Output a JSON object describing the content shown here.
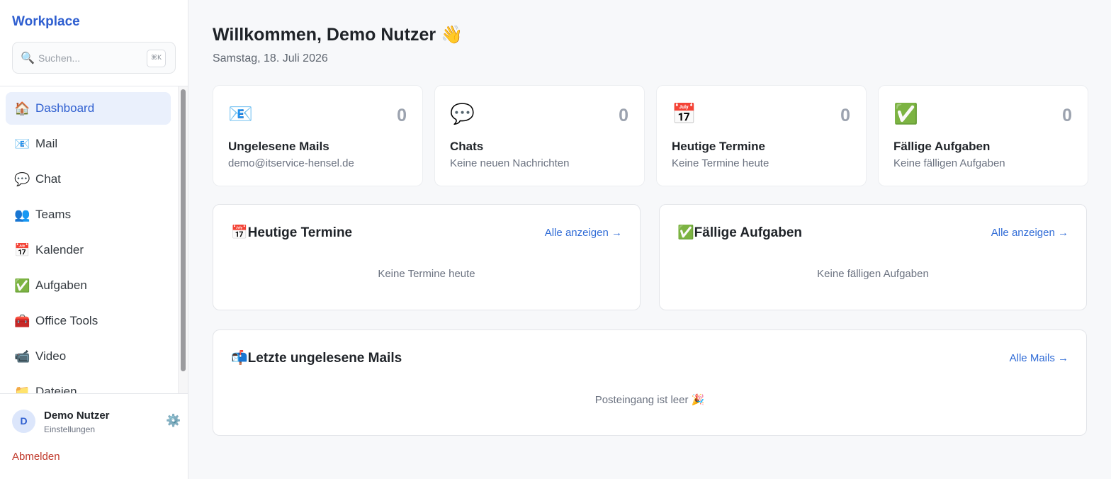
{
  "app": {
    "brand": "Workplace",
    "search_placeholder": "Suchen...",
    "search_shortcut": "⌘K"
  },
  "nav": [
    {
      "icon": "🏠",
      "icon_name": "house-icon",
      "label": "Dashboard",
      "active": true
    },
    {
      "icon": "📧",
      "icon_name": "mail-icon",
      "label": "Mail"
    },
    {
      "icon": "💬",
      "icon_name": "speech-bubble-icon",
      "label": "Chat"
    },
    {
      "icon": "👥",
      "icon_name": "people-icon",
      "label": "Teams"
    },
    {
      "icon": "📅",
      "icon_name": "calendar-icon",
      "label": "Kalender"
    },
    {
      "icon": "✅",
      "icon_name": "checkmark-icon",
      "label": "Aufgaben"
    },
    {
      "icon": "🧰",
      "icon_name": "toolbox-icon",
      "label": "Office Tools"
    },
    {
      "icon": "📹",
      "icon_name": "video-camera-icon",
      "label": "Video"
    },
    {
      "icon": "📁",
      "icon_name": "folder-icon",
      "label": "Dateien"
    }
  ],
  "user": {
    "initial": "D",
    "name": "Demo Nutzer",
    "sub": "Einstellungen",
    "settings_icon": "⚙️",
    "logout": "Abmelden"
  },
  "header": {
    "title": "Willkommen, Demo Nutzer 👋",
    "date": "Samstag, 18. Juli 2026"
  },
  "stats": [
    {
      "icon": "📧",
      "icon_name": "mail-icon",
      "value": "0",
      "title": "Ungelesene Mails",
      "sub": "demo@itservice-hensel.de"
    },
    {
      "icon": "💬",
      "icon_name": "speech-bubble-icon",
      "value": "0",
      "title": "Chats",
      "sub": "Keine neuen Nachrichten"
    },
    {
      "icon": "📅",
      "icon_name": "calendar-icon",
      "value": "0",
      "title": "Heutige Termine",
      "sub": "Keine Termine heute"
    },
    {
      "icon": "✅",
      "icon_name": "checkmark-icon",
      "value": "0",
      "title": "Fällige Aufgaben",
      "sub": "Keine fälligen Aufgaben"
    }
  ],
  "panels": {
    "termine": {
      "title": "📅Heutige Termine",
      "link": "Alle anzeigen →",
      "empty": "Keine Termine heute"
    },
    "aufgaben": {
      "title": "✅Fällige Aufgaben",
      "link": "Alle anzeigen →",
      "empty": "Keine fälligen Aufgaben"
    },
    "mails": {
      "title": "📬Letzte ungelesene Mails",
      "link": "Alle Mails →",
      "empty": "Posteingang ist leer 🎉"
    }
  }
}
